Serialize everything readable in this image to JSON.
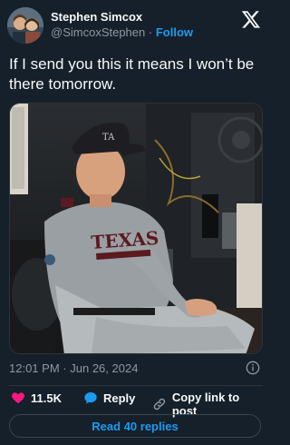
{
  "author": {
    "name": "Stephen Simcox",
    "handle": "@SimcoxStephen",
    "separator": "·",
    "follow_label": "Follow"
  },
  "tweet": {
    "text": "If I send you this it means I won’t be there tomorrow.",
    "time": "12:01 PM",
    "date": "Jun 26, 2024",
    "separator": "·"
  },
  "media": {
    "jersey_text": "TEXAS",
    "description_icon": "photo"
  },
  "actions": {
    "likes": "11.5K",
    "reply_label": "Reply",
    "copy_label": "Copy link to post"
  },
  "read_replies_label": "Read 40 replies",
  "colors": {
    "background": "#15202b",
    "accent": "#1d9bf0",
    "like": "#f91880",
    "muted": "#8b98a5"
  }
}
